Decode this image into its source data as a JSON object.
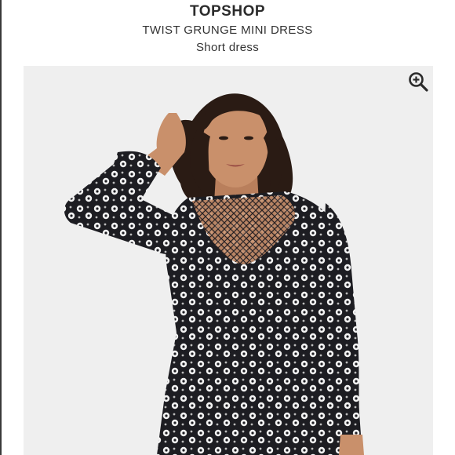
{
  "listing": {
    "brand": "TOPSHOP",
    "product_name": "TWIST GRUNGE MINI DRESS",
    "category": "Short dress"
  },
  "icons": {
    "zoom": "zoom-in-icon"
  },
  "colors": {
    "photo_background": "#efefef",
    "dress_base": "#1d1d22",
    "print_petal": "#f2f2f2",
    "hair": "#2a1b14",
    "skin": "#c9906b"
  }
}
